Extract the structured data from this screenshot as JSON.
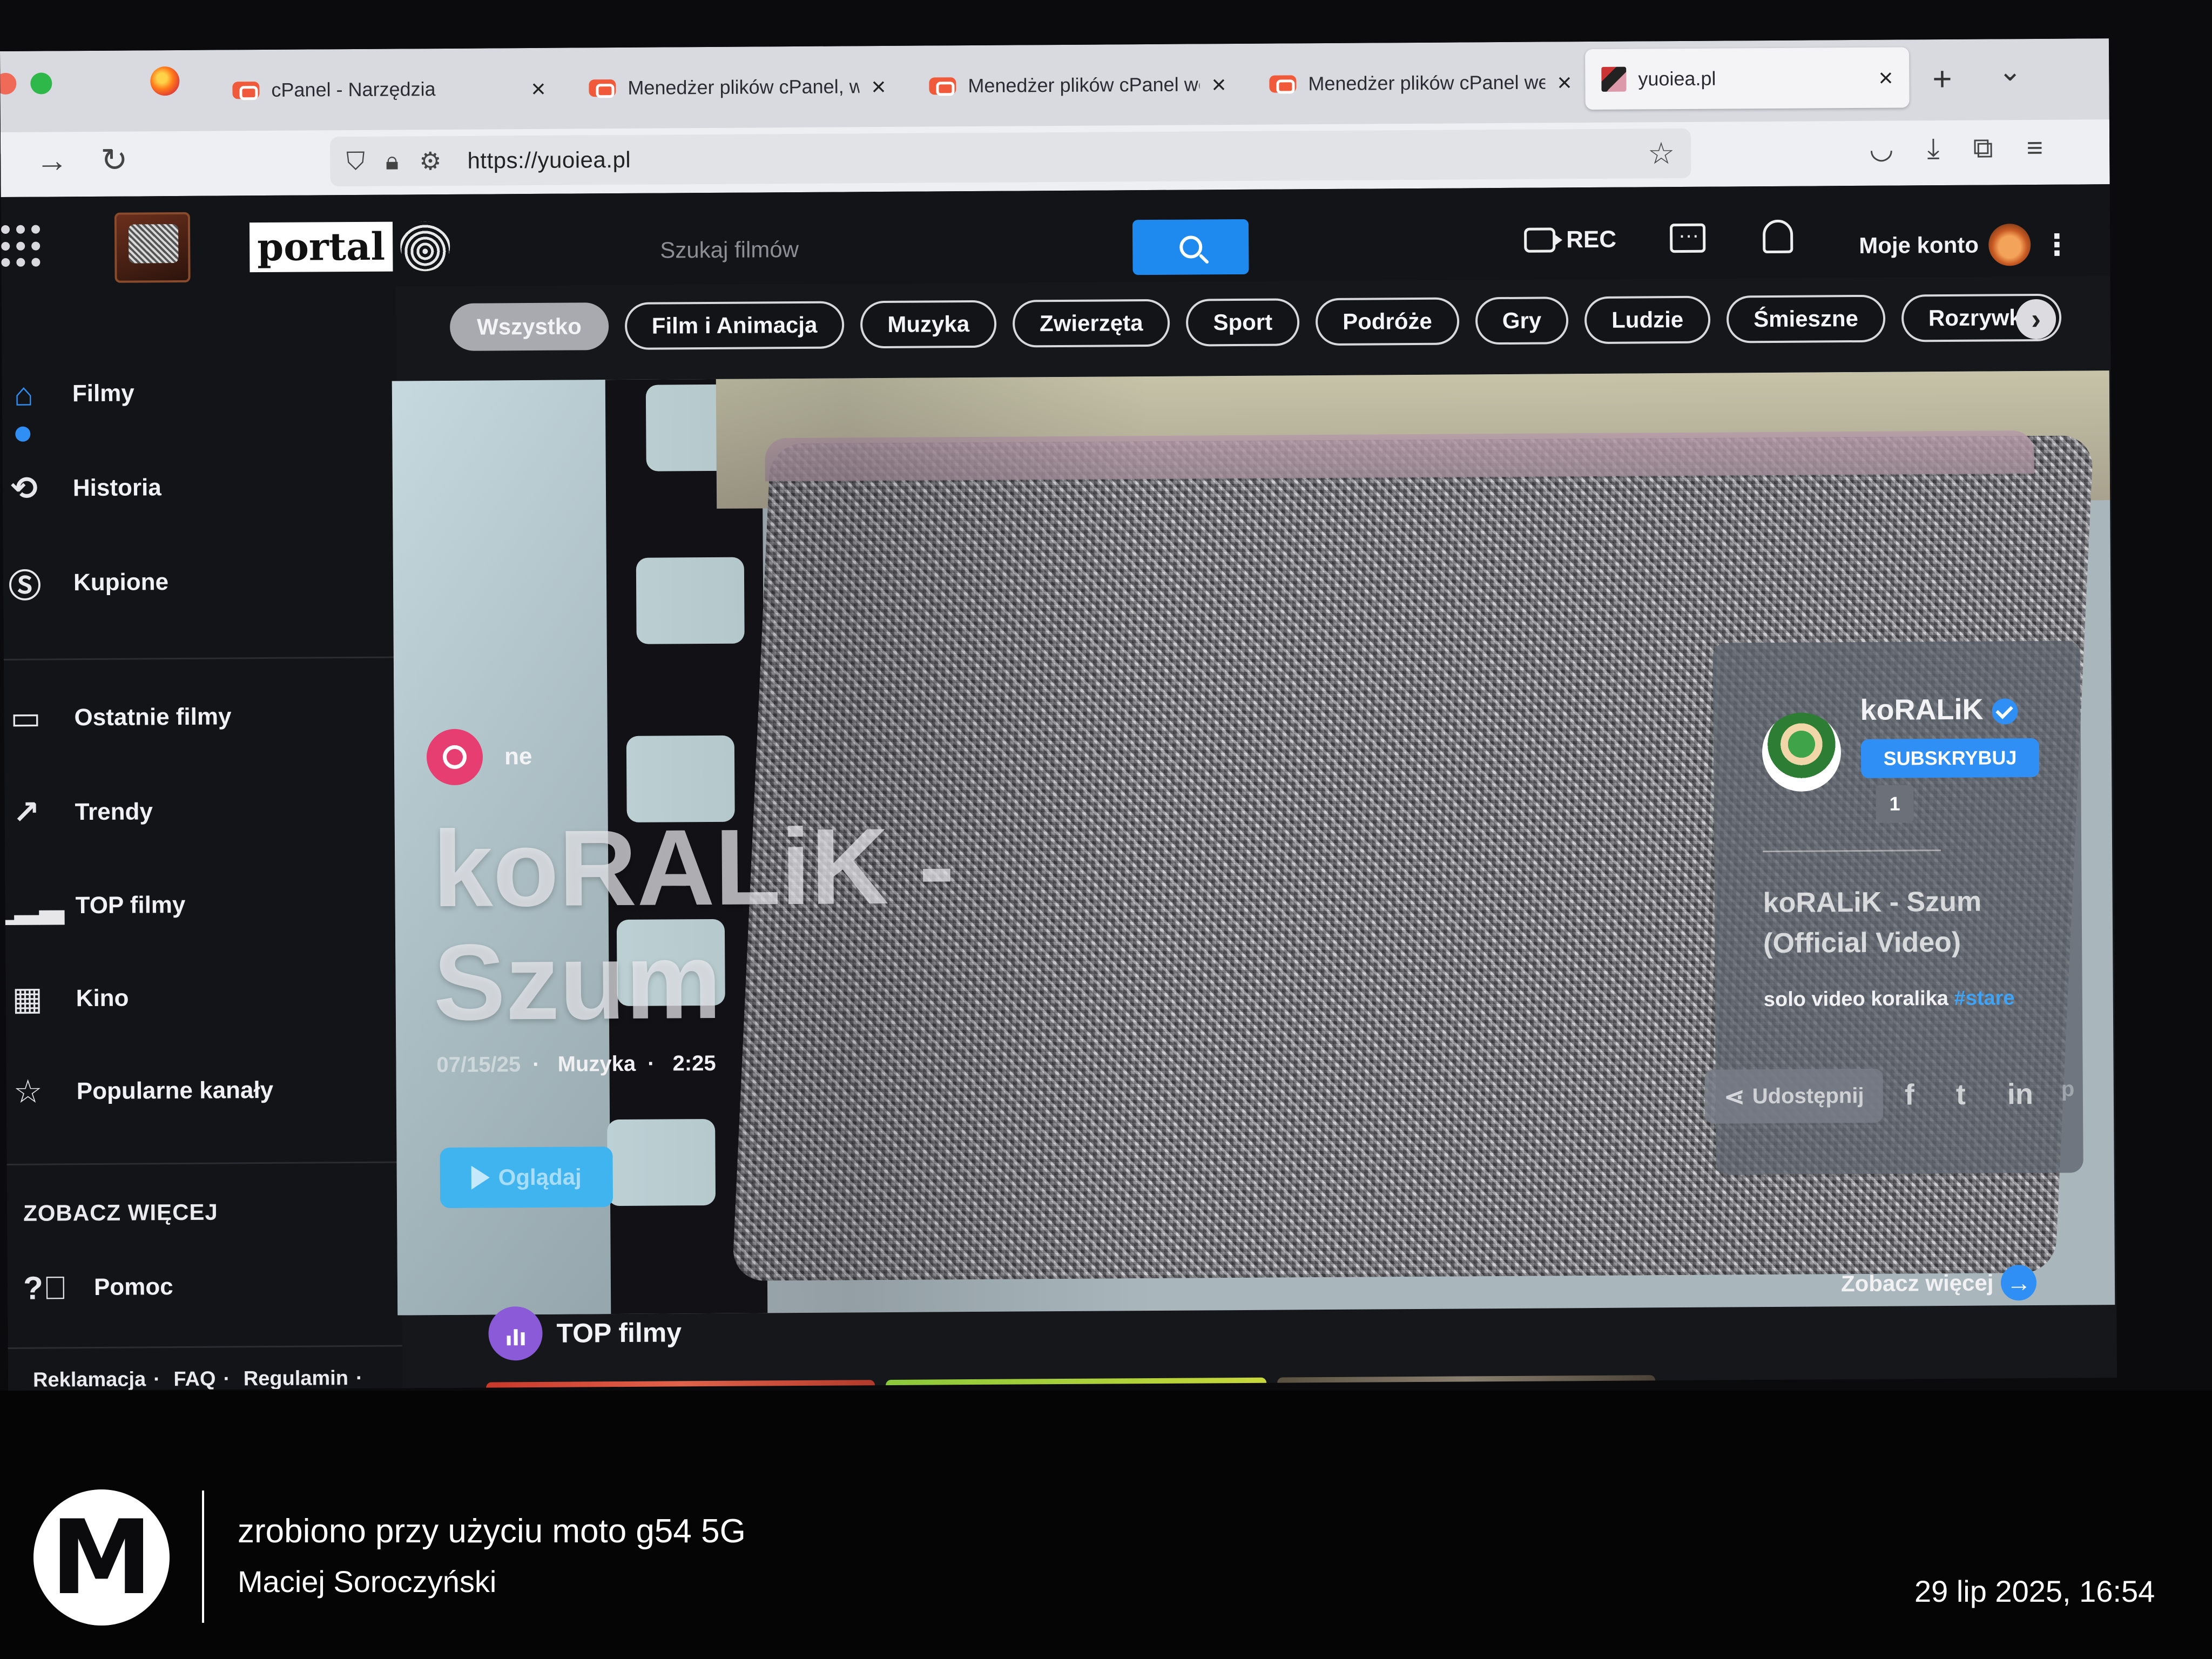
{
  "browser": {
    "tabs": [
      {
        "label": "cPanel - Narzędzia",
        "favicon": "cpanel-icon"
      },
      {
        "label": "Menedżer plików cPanel, we",
        "favicon": "cpanel-icon"
      },
      {
        "label": "Menedżer plików cPanel we",
        "favicon": "cpanel-icon"
      },
      {
        "label": "Menedżer plików cPanel we",
        "favicon": "cpanel-icon"
      },
      {
        "label": "yuoiea.pl",
        "favicon": "site-icon",
        "active": true
      }
    ],
    "url": "https://yuoiea.pl"
  },
  "site": {
    "logo_text": "portal",
    "search_placeholder": "Szukaj filmów",
    "rec_label": "REC",
    "account_label": "Moje konto"
  },
  "sidebar": {
    "items": [
      {
        "label": "Filmy",
        "icon": "home-icon",
        "active": true
      },
      {
        "label": "Historia",
        "icon": "history-icon"
      },
      {
        "label": "Kupione",
        "icon": "dollar-icon"
      },
      {
        "label": "Ostatnie filmy",
        "icon": "camera-icon"
      },
      {
        "label": "Trendy",
        "icon": "trend-icon"
      },
      {
        "label": "TOP filmy",
        "icon": "bar-chart-icon"
      },
      {
        "label": "Kino",
        "icon": "film-icon"
      },
      {
        "label": "Popularne kanały",
        "icon": "star-icon"
      }
    ],
    "more_heading": "ZOBACZ WIĘCEJ",
    "help_label": "Pomoc",
    "footer_links": [
      "Reklamacja",
      "FAQ",
      "Regulamin"
    ]
  },
  "categories": [
    "Wszystko",
    "Film i Animacja",
    "Muzyka",
    "Zwierzęta",
    "Sport",
    "Podróże",
    "Gry",
    "Ludzie",
    "Śmieszne",
    "Rozrywka"
  ],
  "hero": {
    "featured_label_visible": "ne",
    "title": "koRALiK - Szum",
    "date": "07/15/25",
    "category": "Muzyka",
    "duration": "2:25",
    "watch_label": "Oglądaj"
  },
  "channel": {
    "name": "koRALiK",
    "subscribe_label": "SUBSKRYBUJ",
    "subscriber_count": "1",
    "video_title": "koRALiK - Szum (Official Video)",
    "description": "solo video koralika",
    "hashtag": "#stare",
    "share_label": "Udostępnij",
    "social": [
      "f",
      "t",
      "in",
      "p"
    ]
  },
  "sections": {
    "top_label": "TOP filmy",
    "see_more_label": "Zobacz więcej"
  },
  "watermark": {
    "line1": "zrobiono przy użyciu moto g54 5G",
    "line2": "Maciej Soroczyński",
    "datetime": "29 lip 2025, 16:54"
  },
  "colors": {
    "accent": "#2f8ff5",
    "featured_badge": "#e63e70",
    "watch_button": "#3fb4ef",
    "top_icon": "#8b5ad9"
  }
}
